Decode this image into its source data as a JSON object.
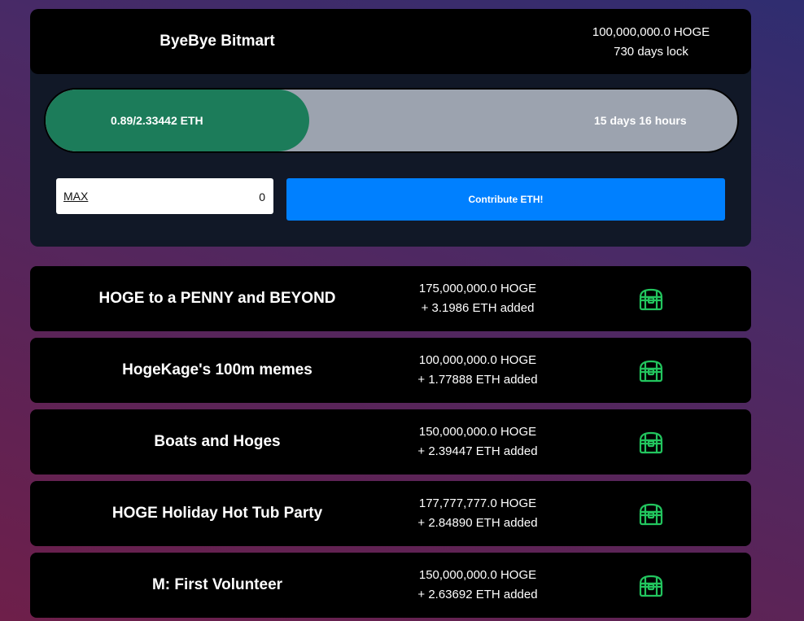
{
  "active_campaign": {
    "title": "ByeBye Bitmart",
    "hoge_amount": "100,000,000.0 HOGE",
    "lock": "730 days lock",
    "progress_text": "0.89/2.33442 ETH",
    "progress_fraction": 0.3813,
    "time_left": "15 days 16 hours",
    "max_label": "MAX",
    "input_value": "0",
    "contribute_label": "Contribute ETH!"
  },
  "campaigns": [
    {
      "title": "HOGE to a PENNY and BEYOND",
      "hoge": "175,000,000.0 HOGE",
      "eth_added": "+ 3.1986 ETH added",
      "icon": "treasure-chest-icon"
    },
    {
      "title": "HogeKage's 100m memes",
      "hoge": "100,000,000.0 HOGE",
      "eth_added": "+ 1.77888 ETH added",
      "icon": "treasure-chest-icon"
    },
    {
      "title": "Boats and Hoges",
      "hoge": "150,000,000.0 HOGE",
      "eth_added": "+ 2.39447 ETH added",
      "icon": "treasure-chest-icon"
    },
    {
      "title": "HOGE Holiday Hot Tub Party",
      "hoge": "177,777,777.0 HOGE",
      "eth_added": "+ 2.84890 ETH added",
      "icon": "treasure-chest-icon"
    },
    {
      "title": "M: First Volunteer",
      "hoge": "150,000,000.0 HOGE",
      "eth_added": "+ 2.63692 ETH added",
      "icon": "treasure-chest-icon"
    }
  ],
  "colors": {
    "progress_fill": "#1c7c5a",
    "progress_track": "#9ca3af",
    "button": "#0080ff",
    "chest_icon": "#22c55e"
  }
}
